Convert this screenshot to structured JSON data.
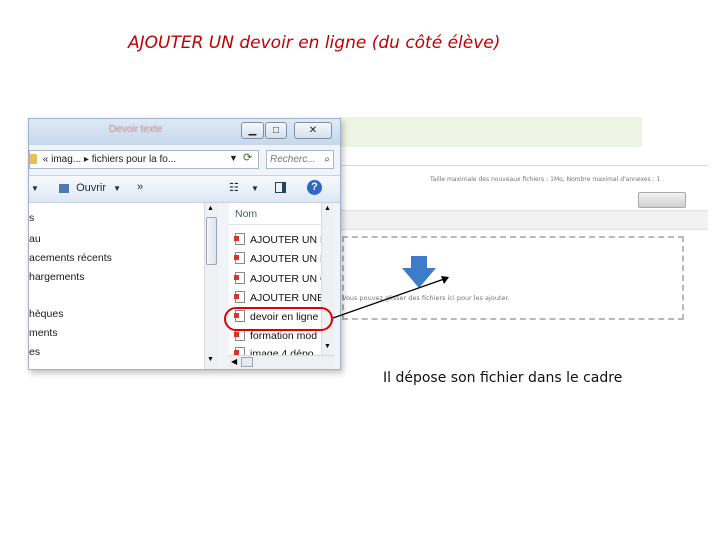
{
  "slide": {
    "title": "AJOUTER UN devoir en ligne (du côté élève)",
    "caption": "Il dépose son fichier dans le cadre"
  },
  "explorer": {
    "window_title": "Devoir texte",
    "address_path": "« imag... ▸ fichiers pour la fo...",
    "search_placeholder": "Recherc...",
    "toolbar": {
      "organize_label": "Ouvrir",
      "more_label": "»"
    },
    "column_header": "Nom",
    "nav_items": [
      "s",
      "au",
      "acements récents",
      "hargements",
      "hèques",
      "ments",
      "es"
    ],
    "files": [
      "AJOUTER UN D",
      "AJOUTER UN D",
      "AJOUTER UN C",
      "AJOUTER UNE",
      "devoir en ligne",
      "formation mod",
      "image 4 dépo"
    ],
    "highlighted_file": "devoir en ligne"
  },
  "moodle": {
    "info_text": "Taille maximale des nouveaux fichiers : 1Mo, Nombre maximal d'annexes : 1",
    "dropzone_text": "Vous pouvez glisser des fichiers ici pour les ajouter."
  },
  "colors": {
    "title": "#c00000",
    "highlight": "#e00000",
    "dropzone_arrow": "#3d7cc9"
  }
}
